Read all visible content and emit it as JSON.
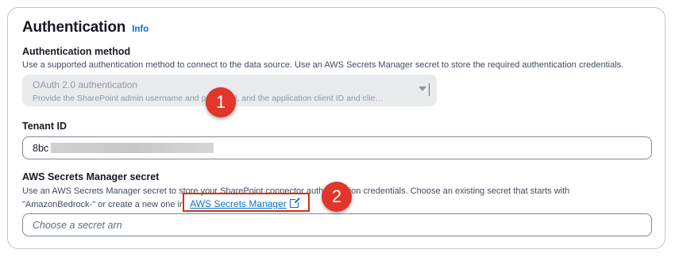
{
  "section": {
    "title": "Authentication",
    "info_link": "Info"
  },
  "auth_method": {
    "label": "Authentication method",
    "description": "Use a supported authentication method to connect to the data source. Use an AWS Secrets Manager secret to store the required authentication credentials.",
    "selected_value": "OAuth 2.0 authentication",
    "selected_description": "Provide the SharePoint admin username and password, and the application client ID and clie…",
    "disabled": true
  },
  "tenant": {
    "label": "Tenant ID",
    "value_visible": "8bc"
  },
  "secret": {
    "label": "AWS Secrets Manager secret",
    "description_line1": "Use an AWS Secrets Manager secret to store your SharePoint connector authentication credentials. Choose an existing secret that starts with",
    "description_line2_prefix": "\"AmazonBedrock-\" or create a new one in",
    "link_text": "AWS Secrets Manager",
    "placeholder": "Choose a secret arn"
  },
  "callouts": [
    "1",
    "2"
  ],
  "colors": {
    "link": "#0972d3",
    "callout": "#e0362c",
    "highlight_border": "#d13212",
    "disabled_bg": "#e9ebed"
  }
}
